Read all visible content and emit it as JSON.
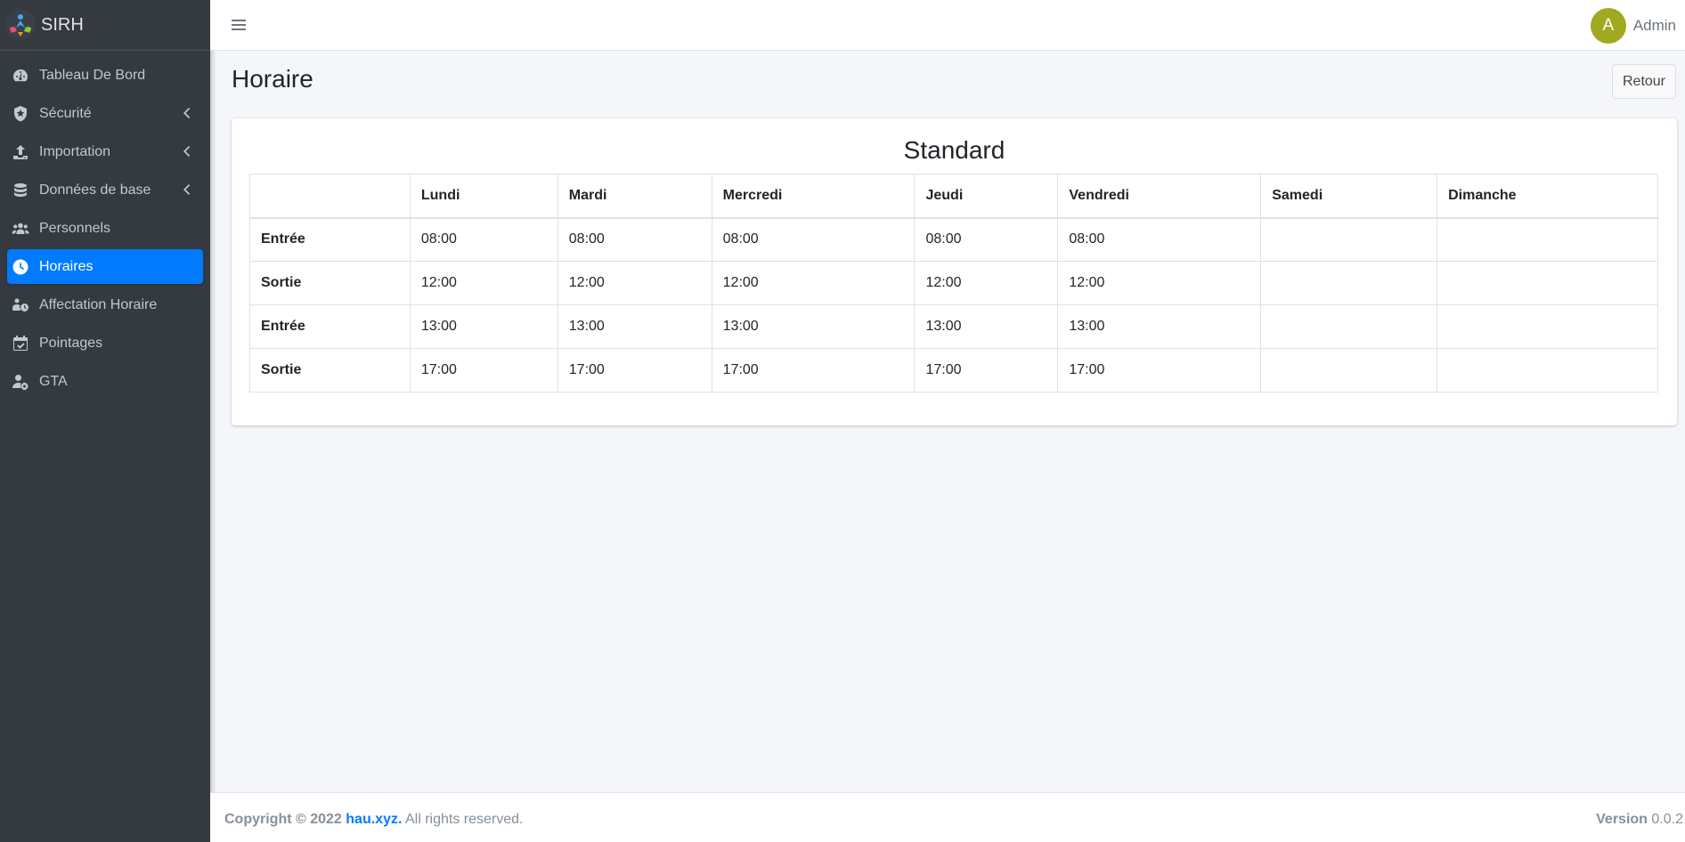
{
  "brand": {
    "name": "SIRH"
  },
  "sidebar": {
    "items": [
      {
        "label": "Tableau De Bord",
        "icon": "dashboard-icon",
        "has_arrow": false,
        "active": false
      },
      {
        "label": "Sécurité",
        "icon": "shield-icon",
        "has_arrow": true,
        "active": false
      },
      {
        "label": "Importation",
        "icon": "upload-icon",
        "has_arrow": true,
        "active": false
      },
      {
        "label": "Données de base",
        "icon": "database-icon",
        "has_arrow": true,
        "active": false
      },
      {
        "label": "Personnels",
        "icon": "users-icon",
        "has_arrow": false,
        "active": false
      },
      {
        "label": "Horaires",
        "icon": "clock-icon",
        "has_arrow": false,
        "active": true
      },
      {
        "label": "Affectation Horaire",
        "icon": "users-clock-icon",
        "has_arrow": false,
        "active": false
      },
      {
        "label": "Pointages",
        "icon": "calendar-check-icon",
        "has_arrow": false,
        "active": false
      },
      {
        "label": "GTA",
        "icon": "user-gear-icon",
        "has_arrow": false,
        "active": false
      }
    ]
  },
  "topbar": {
    "user_initial": "A",
    "user_name": "Admin"
  },
  "page": {
    "title": "Horaire",
    "back_label": "Retour"
  },
  "schedule": {
    "title": "Standard",
    "headers": [
      "",
      "Lundi",
      "Mardi",
      "Mercredi",
      "Jeudi",
      "Vendredi",
      "Samedi",
      "Dimanche"
    ],
    "rows": [
      {
        "label": "Entrée",
        "cells": [
          "08:00",
          "08:00",
          "08:00",
          "08:00",
          "08:00",
          "",
          ""
        ]
      },
      {
        "label": "Sortie",
        "cells": [
          "12:00",
          "12:00",
          "12:00",
          "12:00",
          "12:00",
          "",
          ""
        ]
      },
      {
        "label": "Entrée",
        "cells": [
          "13:00",
          "13:00",
          "13:00",
          "13:00",
          "13:00",
          "",
          ""
        ]
      },
      {
        "label": "Sortie",
        "cells": [
          "17:00",
          "17:00",
          "17:00",
          "17:00",
          "17:00",
          "",
          ""
        ]
      }
    ]
  },
  "footer": {
    "copyright_prefix": "Copyright © 2022",
    "link_text": "hau.xyz.",
    "rights": "All rights reserved.",
    "version_label": "Version",
    "version_value": "0.0.2"
  },
  "colors": {
    "sidebar_bg": "#343a40",
    "active_item": "#007bff",
    "avatar_bg": "#a0a920",
    "content_bg": "#f4f6f9"
  }
}
